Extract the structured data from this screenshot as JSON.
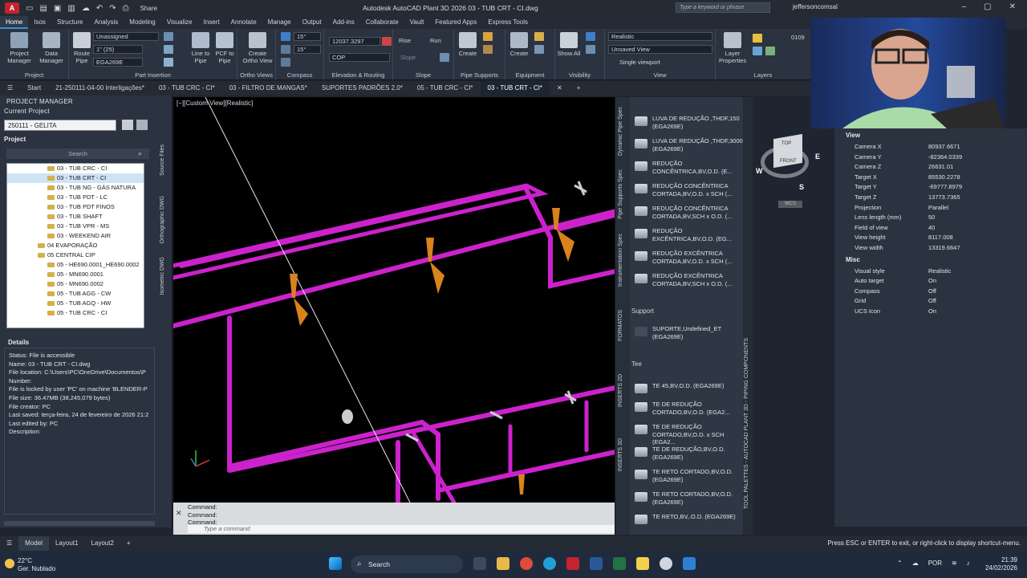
{
  "titlebar": {
    "app_badge": "A",
    "app_badge_suffix": "PRO",
    "share": "Share",
    "title": "Autodesk AutoCAD Plant 3D 2026   03 - TUB CRT - CI.dwg",
    "search_placeholder": "Type a keyword or phrase",
    "user": "jeffersoncomsal"
  },
  "menu": [
    "Home",
    "Isos",
    "Structure",
    "Analysis",
    "Modeling",
    "Visualize",
    "Insert",
    "Annotate",
    "Manage",
    "Output",
    "Add-ins",
    "Collaborate",
    "Vault",
    "Featured Apps",
    "Express Tools"
  ],
  "ribbon": {
    "project_manager": "Project Manager",
    "data_manager": "Data Manager",
    "route_pipe": "Route Pipe",
    "line_to_pipe": "Line to Pipe",
    "pcf_to_pipe": "PCF to Pipe",
    "create_ortho_view": "Create Ortho View",
    "unassigned": "Unassigned",
    "size": "1\" (25)",
    "spec": "EGA269E",
    "angle1": "15°",
    "angle2": "15°",
    "elevation": "12037.3297",
    "cop": "COP",
    "rise": "Rise",
    "run": "Run",
    "slope": "Slope",
    "create1": "Create",
    "create2": "Create",
    "show_all": "Show All",
    "visual_style": "Realistic",
    "saved_view": "Unsaved View",
    "viewport": "Single viewport",
    "layer_properties": "Layer Properties",
    "layer_num": "0109",
    "groups": [
      "Project",
      "Part Insertion",
      "Ortho Views",
      "Compass",
      "Elevation & Routing",
      "Slope",
      "Pipe Supports",
      "Equipment",
      "Visibility",
      "View",
      "Layers"
    ]
  },
  "tabs": [
    "Start",
    "21-250111-04-00 Interligações*",
    "03 - TUB CRC - CI*",
    "03 - FILTRO DE MANGAS*",
    "SUPORTES PADRÕES 2.0*",
    "05 - TUB CRC - CI*",
    "03 - TUB CRT - CI*"
  ],
  "project_manager": {
    "title": "PROJECT MANAGER",
    "current_project_label": "Current Project",
    "current_project": "250111 - GELITA",
    "project_label": "Project",
    "search": "Search",
    "tree": [
      {
        "label": "03 - TUB CRC - CI",
        "lvl": 2
      },
      {
        "label": "03 - TUB CRT - CI",
        "lvl": 2,
        "sel": true
      },
      {
        "label": "03 - TUB NG - GÁS NATURA",
        "lvl": 2
      },
      {
        "label": "03 - TUB PDT - LC",
        "lvl": 2
      },
      {
        "label": "03 - TUB PDT FINOS",
        "lvl": 2
      },
      {
        "label": "03 - TUB SHAFT",
        "lvl": 2
      },
      {
        "label": "03 - TUB VPR - MS",
        "lvl": 2
      },
      {
        "label": "03 - WEEKEND AIR",
        "lvl": 2
      },
      {
        "label": "04 EVAPORAÇÃO",
        "lvl": 1
      },
      {
        "label": "05 CENTRAL CIP",
        "lvl": 1
      },
      {
        "label": "05 - HE690.0001_HE690.0002",
        "lvl": 2
      },
      {
        "label": "05 - MN690.0001",
        "lvl": 2
      },
      {
        "label": "05 - MN690.0002",
        "lvl": 2
      },
      {
        "label": "05 - TUB AGG - CW",
        "lvl": 2
      },
      {
        "label": "05 - TUB AGQ - HW",
        "lvl": 2
      },
      {
        "label": "05 - TUB CRC - CI",
        "lvl": 2
      }
    ],
    "details_label": "Details",
    "details": [
      "Status: File is accessible",
      "Name: 03 - TUB CRT - CI.dwg",
      "File location: C:\\Users\\PC\\OneDrive\\Documentos\\P",
      "Number:",
      "File is locked by user 'PC' on machine 'BLENDER-P",
      "File size: 36.47MB (38,245,079 bytes)",
      "File creator: PC",
      "Last saved: terça-feira, 24 de fevereiro de 2026 21:2",
      "Last edited by: PC",
      "Description:"
    ],
    "side_tabs": [
      "Source Files",
      "Orthographic DWG",
      "Isometric DWG"
    ]
  },
  "viewport": {
    "label": "[−][Custom View][Realistic]",
    "pipe_color": "#cc22cc",
    "support_color": "#d9821e"
  },
  "viewcube": {
    "top": "TOP",
    "front": "FRONT",
    "w": "W",
    "s": "S",
    "e": "E",
    "wcs": "WCS"
  },
  "command": {
    "lines": [
      "Command:",
      "Command:",
      "Command:"
    ],
    "placeholder": "Type a command"
  },
  "palette": {
    "tabs": [
      "Dynamic Pipe Spec",
      "Pipe Supports Spec",
      "Instrumentation Spec",
      "FORMATOS",
      "INSERTS 2D",
      "INSERTS 3D"
    ],
    "right_tab": "TOOL PALETTES - AUTOCAD PLANT 3D - PIPING COMPONENTS",
    "items_a": [
      "LUVA DE REDUÇÃO ,THDF,150 (EGA269E)",
      "LUVA DE REDUÇÃO ,THDF,3000 (EGA269E)",
      "REDUÇÃO CONCÊNTRICA,BV,O.D. (E...",
      "REDUÇÃO CONCÊNTRICA CORTADA,BV,O.D. x SCH (...",
      "REDUÇÃO CONCÊNTRICA CORTADA,BV,SCH x O.D. (...",
      "REDUÇÃO EXCÊNTRICA,BV,O.D. (EG...",
      "REDUÇÃO EXCÊNTRICA CORTADA,BV,O.D. x SCH (...",
      "REDUÇÃO EXCÊNTRICA CORTADA,BV,SCH x O.D. (..."
    ],
    "support_header": "Support",
    "support_item": "SUPORTE,Undefined_ET (EGA269E)",
    "tee_header": "Tee",
    "tee_items": [
      "TE 45,BV,O.D. (EGA269E)",
      "TE DE REDUÇÃO CORTADO,BV,O.D. (EGA2...",
      "TE DE REDUÇÃO CORTADO,BV,O.D. x SCH (EGA2...",
      "TE DE REDUÇÃO,BV,O.D. (EGA269E)",
      "TE RETO CORTADO,BV,O.D. (EGA269E)",
      "TE RETO CORTADO,BV,O.D. (EGA269E)",
      "TE RETO,BV,.O.D. (EGA269E)"
    ]
  },
  "properties": {
    "view_header": "View",
    "view": [
      {
        "k": "Camera X",
        "v": "80937.6671"
      },
      {
        "k": "Camera Y",
        "v": "-82364.0339"
      },
      {
        "k": "Camera Z",
        "v": "26631.01"
      },
      {
        "k": "Target X",
        "v": "85530.2278"
      },
      {
        "k": "Target Y",
        "v": "-69777.8979"
      },
      {
        "k": "Target Z",
        "v": "13773.7365"
      },
      {
        "k": "Projection",
        "v": "Parallel"
      },
      {
        "k": "Lens length (mm)",
        "v": "50"
      },
      {
        "k": "Field of view",
        "v": "40"
      },
      {
        "k": "View height",
        "v": "8117.008"
      },
      {
        "k": "View width",
        "v": "13319.6647"
      }
    ],
    "misc_header": "Misc",
    "misc": [
      {
        "k": "Visual style",
        "v": "Realistic"
      },
      {
        "k": "Auto target",
        "v": "On"
      },
      {
        "k": "Compass",
        "v": "Off"
      },
      {
        "k": "Grid",
        "v": "Off"
      },
      {
        "k": "UCS Icon",
        "v": "On"
      }
    ]
  },
  "status": {
    "tabs": [
      "Model",
      "Layout1",
      "Layout2",
      "+"
    ],
    "hint": "Press ESC or ENTER to exit, or right-click to display shortcut-menu."
  },
  "taskbar": {
    "temp": "22°C",
    "weather": "Ger. Nublado",
    "search": "Search",
    "lang": "POR",
    "time": "21:39",
    "date": "24/02/2026"
  }
}
